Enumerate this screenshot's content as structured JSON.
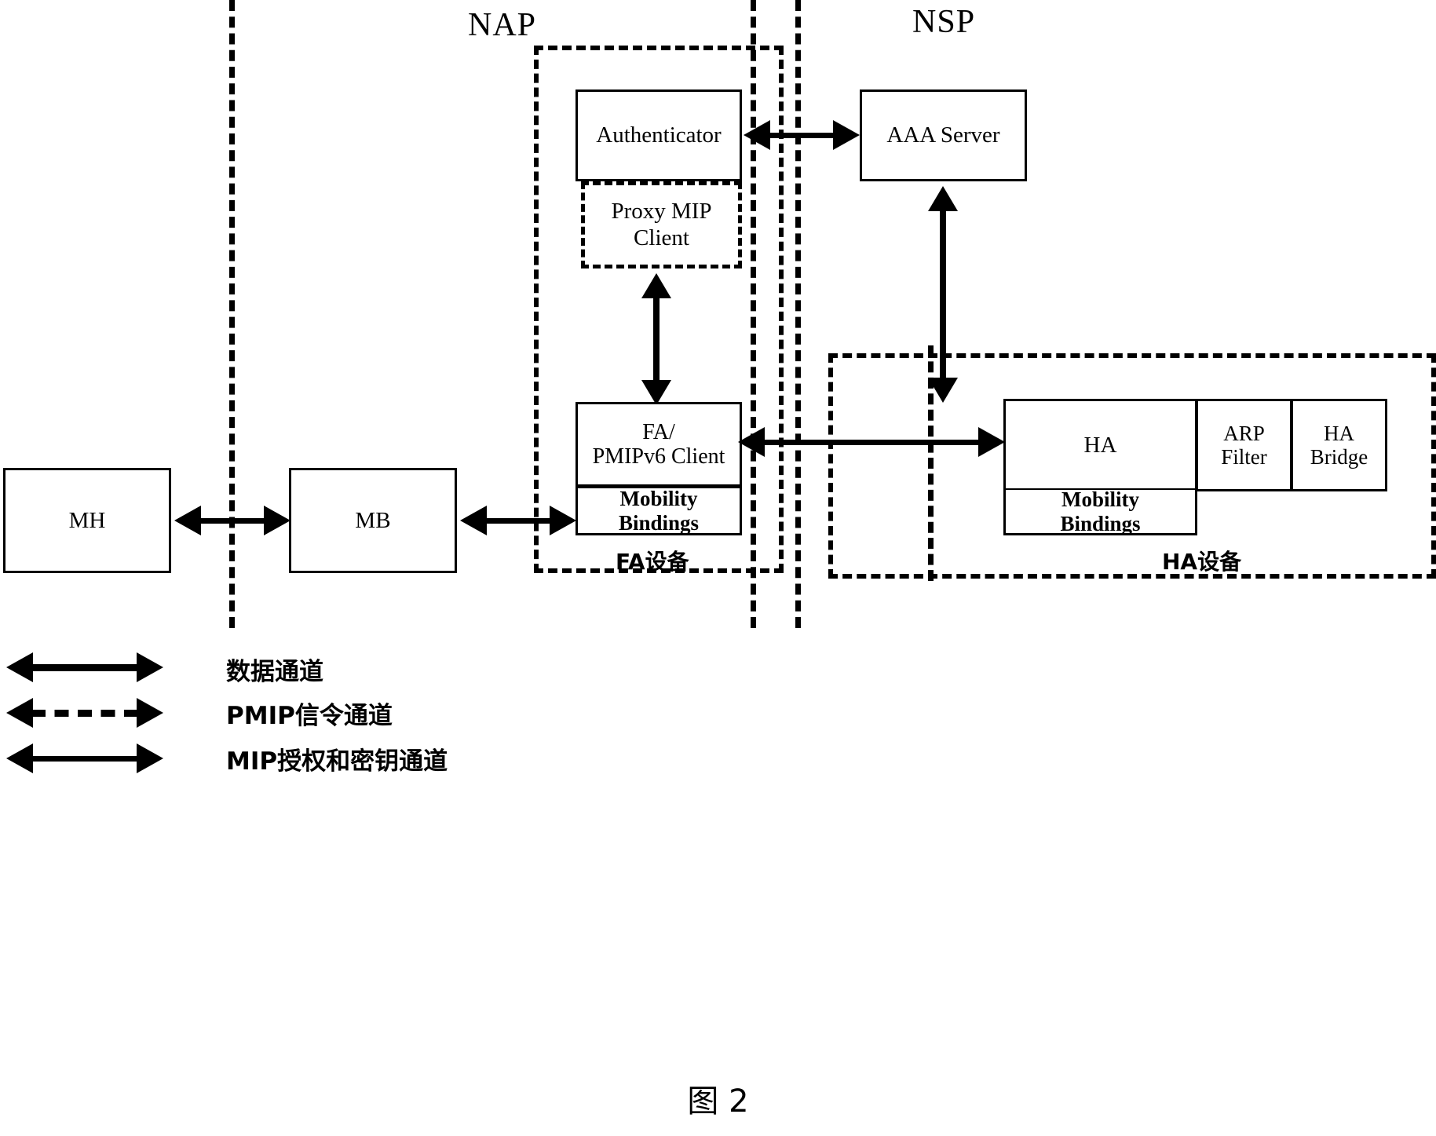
{
  "figure": {
    "caption": "图 2"
  },
  "regions": [
    {
      "id": "nap",
      "label": "NAP"
    },
    {
      "id": "nsp",
      "label": "NSP"
    }
  ],
  "nodes": {
    "mh": {
      "label": "MH"
    },
    "mb": {
      "label": "MB"
    },
    "authenticator": {
      "label": "Authenticator"
    },
    "proxy_mip_client": {
      "label": "Proxy MIP\nClient",
      "line1": "Proxy MIP",
      "line2": "Client"
    },
    "aaa_server": {
      "label": "AAA Server"
    },
    "fa": {
      "line1": "FA/",
      "line2": "PMIPv6 Client"
    },
    "fa_mobility_bindings": {
      "line1": "Mobility",
      "line2": "Bindings"
    },
    "ha": {
      "label": "HA"
    },
    "ha_mobility_bindings": {
      "line1": "Mobility",
      "line2": "Bindings"
    },
    "arp_filter": {
      "line1": "ARP",
      "line2": "Filter"
    },
    "ha_bridge": {
      "line1": "HA",
      "line2": "Bridge"
    }
  },
  "device_labels": {
    "fa_device": "FA设备",
    "ha_device": "HA设备"
  },
  "legend": {
    "items": [
      {
        "style": "solid-thick",
        "label": "数据通道"
      },
      {
        "style": "dashed",
        "label": "PMIP信令通道"
      },
      {
        "style": "solid-thin",
        "label": "MIP授权和密钥通道"
      }
    ]
  },
  "colors": {
    "stroke": "#000000",
    "background": "#ffffff"
  }
}
